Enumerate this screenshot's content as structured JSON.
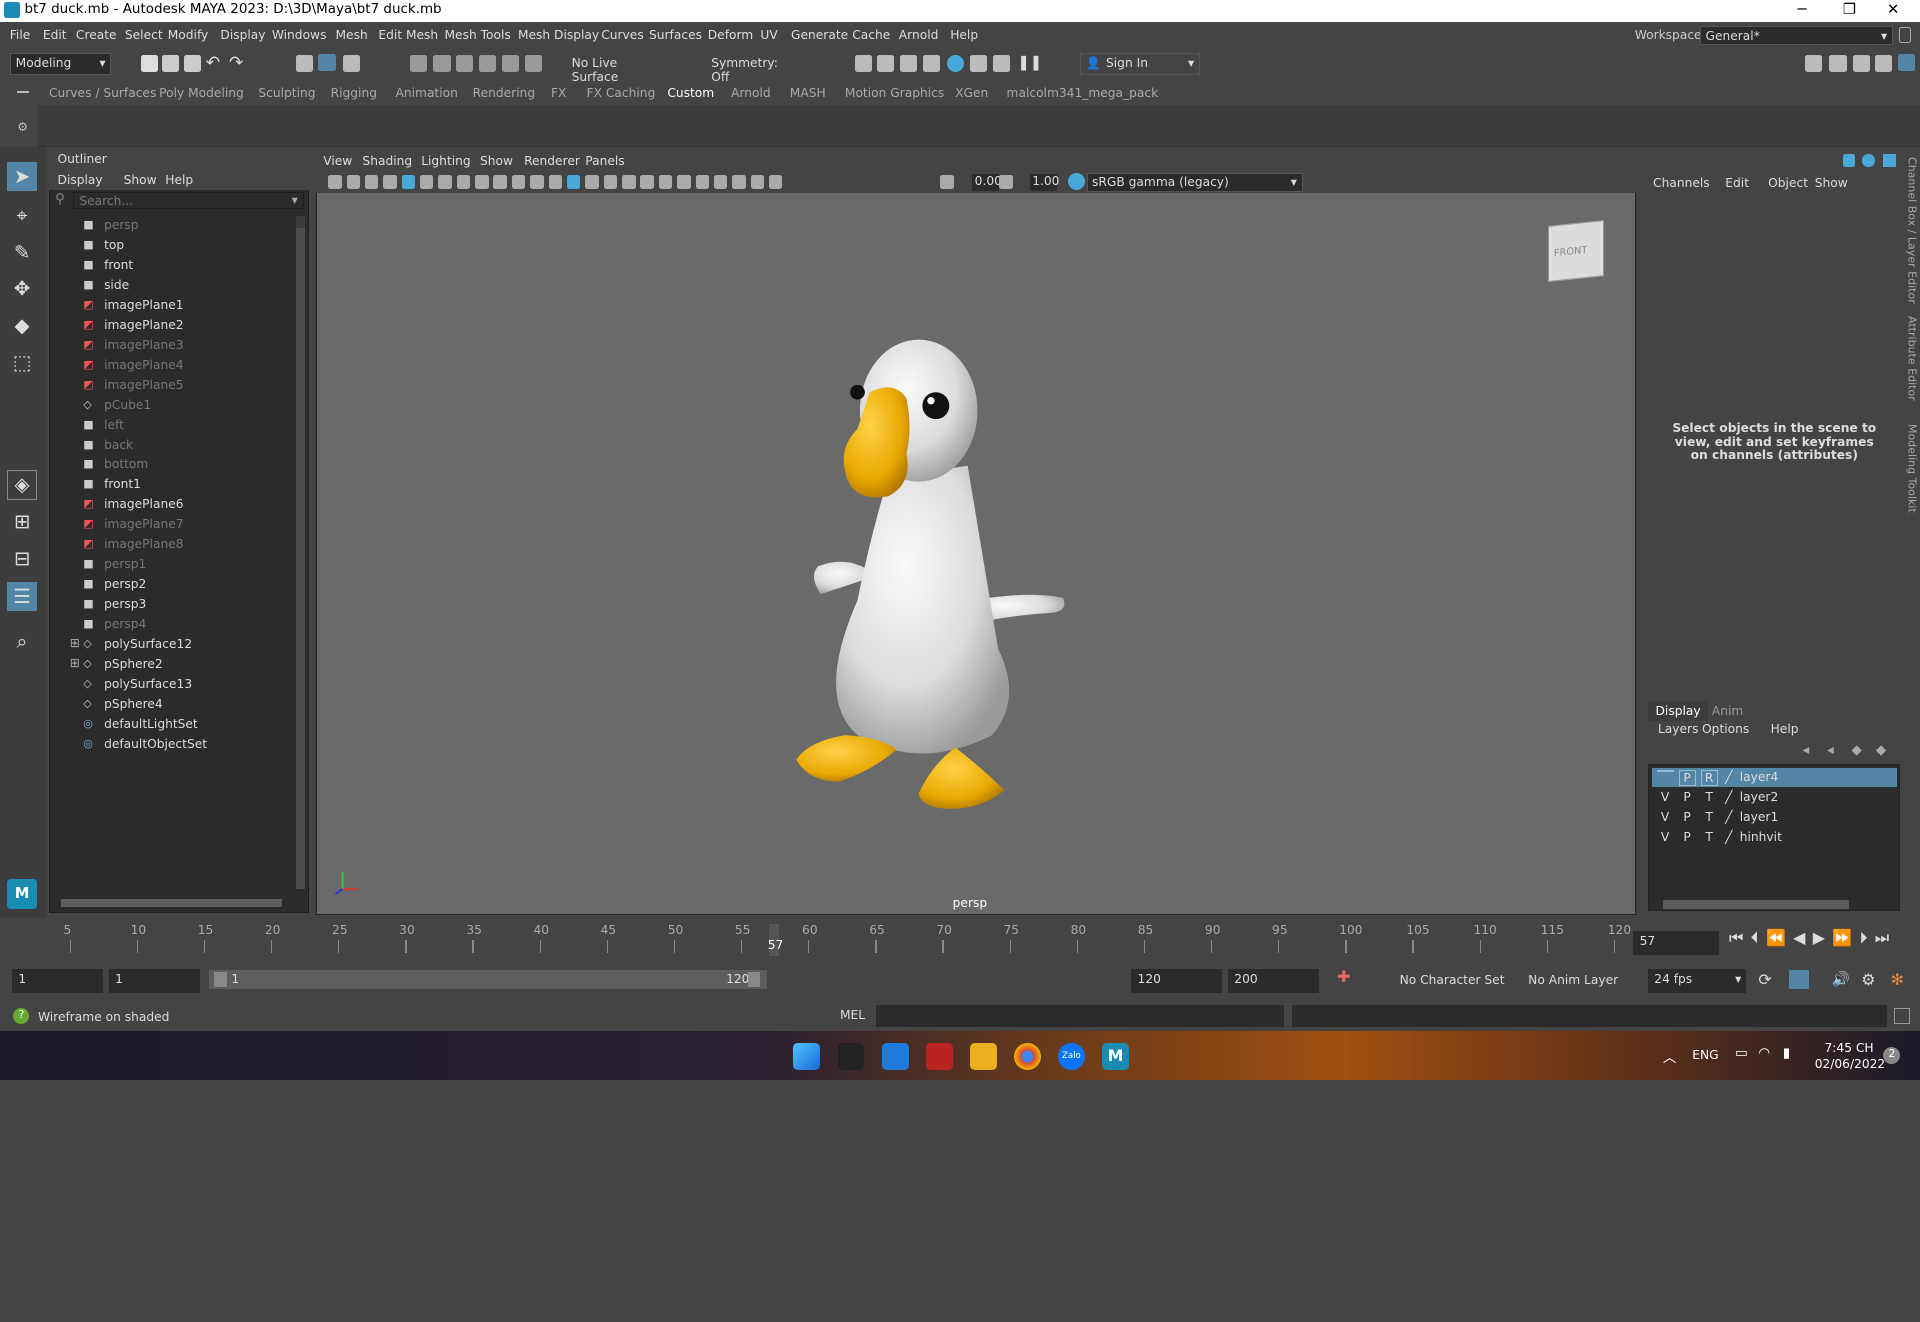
{
  "window": {
    "title": "bt7 duck.mb - Autodesk MAYA 2023: D:\\3D\\Maya\\bt7 duck.mb"
  },
  "menu": [
    "File",
    "Edit",
    "Create",
    "Select",
    "Modify",
    "Display",
    "Windows",
    "Mesh",
    "Edit Mesh",
    "Mesh Tools",
    "Mesh Display",
    "Curves",
    "Surfaces",
    "Deform",
    "UV",
    "Generate",
    "Cache",
    "Arnold",
    "Help"
  ],
  "workspace": {
    "label": "Workspace:",
    "value": "General*"
  },
  "toolbar": {
    "mode": "Modeling",
    "live_surface": "No Live Surface",
    "symmetry": "Symmetry: Off",
    "sign_in": "Sign In"
  },
  "shelf_tabs": [
    "Curves / Surfaces",
    "Poly Modeling",
    "Sculpting",
    "Rigging",
    "Animation",
    "Rendering",
    "FX",
    "FX Caching",
    "Custom",
    "Arnold",
    "MASH",
    "Motion Graphics",
    "XGen",
    "malcolm341_mega_pack"
  ],
  "shelf_active": "Custom",
  "outliner": {
    "title": "Outliner",
    "menu": [
      "Display",
      "Show",
      "Help"
    ],
    "search_placeholder": "Search...",
    "items": [
      {
        "label": "persp",
        "icon": "camera-icon",
        "dim": true
      },
      {
        "label": "top",
        "icon": "camera-icon",
        "dim": false
      },
      {
        "label": "front",
        "icon": "camera-icon",
        "dim": false
      },
      {
        "label": "side",
        "icon": "camera-icon",
        "dim": false
      },
      {
        "label": "imagePlane1",
        "icon": "image-plane-icon",
        "dim": false
      },
      {
        "label": "imagePlane2",
        "icon": "image-plane-icon",
        "dim": false
      },
      {
        "label": "imagePlane3",
        "icon": "image-plane-icon",
        "dim": true
      },
      {
        "label": "imagePlane4",
        "icon": "image-plane-icon",
        "dim": true
      },
      {
        "label": "imagePlane5",
        "icon": "image-plane-icon",
        "dim": true
      },
      {
        "label": "pCube1",
        "icon": "mesh-icon",
        "dim": true
      },
      {
        "label": "left",
        "icon": "camera-icon",
        "dim": true
      },
      {
        "label": "back",
        "icon": "camera-icon",
        "dim": true
      },
      {
        "label": "bottom",
        "icon": "camera-icon",
        "dim": true
      },
      {
        "label": "front1",
        "icon": "camera-icon",
        "dim": false
      },
      {
        "label": "imagePlane6",
        "icon": "image-plane-icon",
        "dim": false
      },
      {
        "label": "imagePlane7",
        "icon": "image-plane-icon",
        "dim": true
      },
      {
        "label": "imagePlane8",
        "icon": "image-plane-icon",
        "dim": true
      },
      {
        "label": "persp1",
        "icon": "camera-icon",
        "dim": true
      },
      {
        "label": "persp2",
        "icon": "camera-icon",
        "dim": false
      },
      {
        "label": "persp3",
        "icon": "camera-icon",
        "dim": false
      },
      {
        "label": "persp4",
        "icon": "camera-icon",
        "dim": true
      },
      {
        "label": "polySurface12",
        "icon": "mesh-icon",
        "dim": false,
        "expand": true
      },
      {
        "label": "pSphere2",
        "icon": "mesh-icon",
        "dim": false,
        "expand": true
      },
      {
        "label": "polySurface13",
        "icon": "mesh-icon",
        "dim": false
      },
      {
        "label": "pSphere4",
        "icon": "mesh-icon",
        "dim": false
      },
      {
        "label": "defaultLightSet",
        "icon": "set-icon",
        "dim": false
      },
      {
        "label": "defaultObjectSet",
        "icon": "set-icon",
        "dim": false
      }
    ]
  },
  "viewport": {
    "menu": [
      "View",
      "Shading",
      "Lighting",
      "Show",
      "Renderer",
      "Panels"
    ],
    "exposure": "0.00",
    "gamma": "1.00",
    "colorspace": "sRGB gamma (legacy)",
    "camera_label": "persp",
    "cube_label": "FRONT"
  },
  "channelbox": {
    "menu": [
      "Channels",
      "Edit",
      "Object",
      "Show"
    ],
    "message": "Select objects in the scene to view, edit and set keyframes on channels (attributes)",
    "side_tabs": [
      "Channel Box / Layer Editor",
      "Attribute Editor",
      "Modeling Toolkit"
    ]
  },
  "layers": {
    "tabs": [
      "Display",
      "Anim"
    ],
    "menu": [
      "Layers",
      "Options",
      "Help"
    ],
    "rows": [
      {
        "v": "",
        "p": "P",
        "t": "R",
        "name": "layer4",
        "selected": true
      },
      {
        "v": "V",
        "p": "P",
        "t": "T",
        "name": "layer2",
        "selected": false
      },
      {
        "v": "V",
        "p": "P",
        "t": "T",
        "name": "layer1",
        "selected": false
      },
      {
        "v": "V",
        "p": "P",
        "t": "T",
        "name": "hinhvit",
        "selected": false
      }
    ]
  },
  "timeline": {
    "ticks": [
      5,
      10,
      15,
      20,
      25,
      30,
      35,
      40,
      45,
      50,
      55,
      60,
      65,
      70,
      75,
      80,
      85,
      90,
      95,
      100,
      105,
      110,
      115,
      120
    ],
    "current_frame": "57",
    "current_field": "57"
  },
  "range": {
    "start": "1",
    "start2": "1",
    "slider_start": "1",
    "slider_end": "120",
    "end": "120",
    "end2": "200",
    "character_set": "No Character Set",
    "anim_layer": "No Anim Layer",
    "fps": "24 fps"
  },
  "helpline": {
    "message": "Wireframe on shaded",
    "script_lang": "MEL"
  },
  "taskbar": {
    "lang": "ENG",
    "time": "7:45 CH",
    "date": "02/06/2022",
    "notif": "2",
    "zalo_label": "Zalo"
  },
  "colors": {
    "duck_body": "#e8e8e8",
    "duck_beak": "#f0b400",
    "selected_layer": "#5285a6",
    "viewport_bg": "#6a6a6a"
  }
}
